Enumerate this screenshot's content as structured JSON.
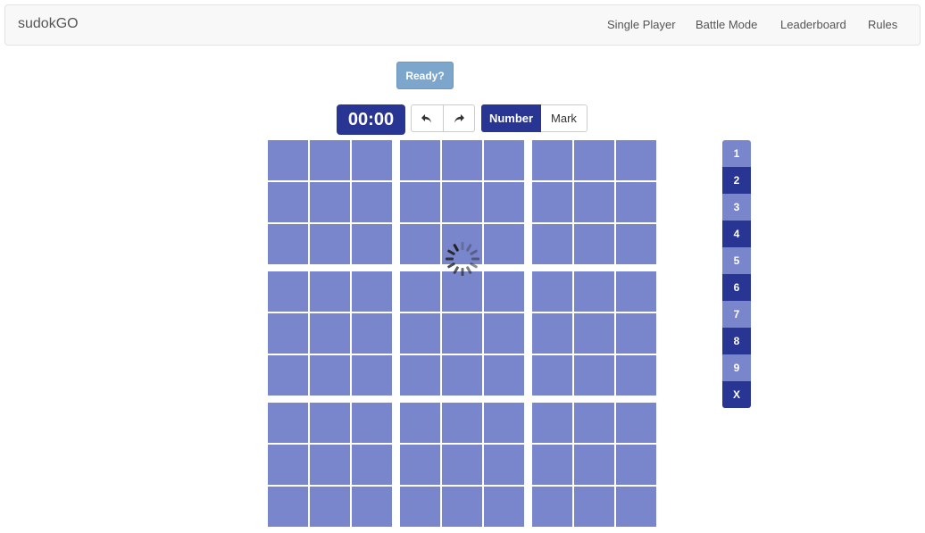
{
  "navbar": {
    "brand": "sudokGO",
    "links": [
      "Single Player",
      "Battle Mode",
      "Leaderboard",
      "Rules"
    ]
  },
  "ready_label": "Ready?",
  "timer": "00:00",
  "toolbar": {
    "undo_icon": "undo-icon",
    "redo_icon": "redo-icon",
    "mode_number": "Number",
    "mode_mark": "Mark",
    "active_mode": "Number"
  },
  "board": {
    "rows": 9,
    "cols": 9,
    "loading": true
  },
  "numpad": [
    "1",
    "2",
    "3",
    "4",
    "5",
    "6",
    "7",
    "8",
    "9",
    "X"
  ],
  "colors": {
    "primary": "#283593",
    "cell": "#7986cb",
    "ready": "#7da6cc"
  }
}
